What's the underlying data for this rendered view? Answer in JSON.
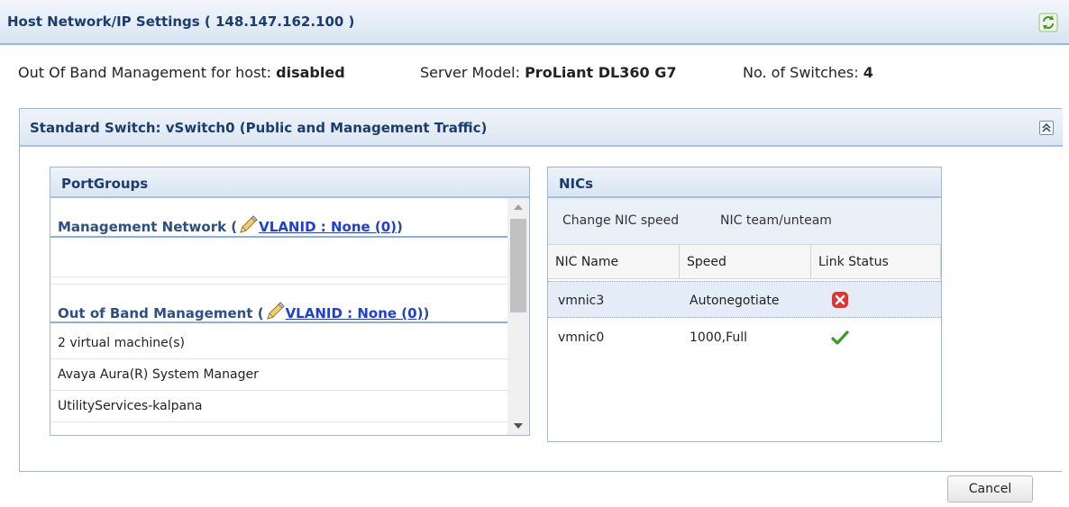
{
  "header": {
    "title": "Host Network/IP Settings ( 148.147.162.100 )"
  },
  "info": {
    "oob_label": "Out Of Band Management for host: ",
    "oob_value": "disabled",
    "model_label": "Server Model: ",
    "model_value": "ProLiant DL360 G7",
    "switches_label": "No. of Switches: ",
    "switches_value": "4"
  },
  "switch_panel": {
    "title": "Standard Switch: vSwitch0 (Public and Management Traffic)",
    "collapse_glyph": "⌃"
  },
  "portgroups": {
    "title": "PortGroups",
    "sections": [
      {
        "name": "Management Network (",
        "vlan": "VLANID : None (0)",
        "close": ")"
      },
      {
        "name": "Out of Band Management (",
        "vlan": "VLANID : None (0)",
        "close": ")"
      }
    ],
    "items": [
      "2 virtual machine(s)",
      "Avaya Aura(R) System Manager",
      "UtilityServices-kalpana"
    ]
  },
  "nics": {
    "title": "NICs",
    "toolbar": {
      "change_speed": "Change NIC speed",
      "team": "NIC team/unteam"
    },
    "columns": [
      "NIC Name",
      "Speed",
      "Link Status"
    ],
    "rows": [
      {
        "name": "vmnic3",
        "speed": "Autonegotiate",
        "link_status": "down",
        "status_icon": "error-icon"
      },
      {
        "name": "vmnic0",
        "speed": "1000,Full",
        "link_status": "up",
        "status_icon": "checkmark-icon"
      }
    ]
  },
  "footer": {
    "cancel_label": "Cancel"
  },
  "colors": {
    "header_text": "#1a3c6e",
    "link": "#1d3fd8",
    "error": "#e0342e",
    "ok": "#3d9a1f"
  }
}
